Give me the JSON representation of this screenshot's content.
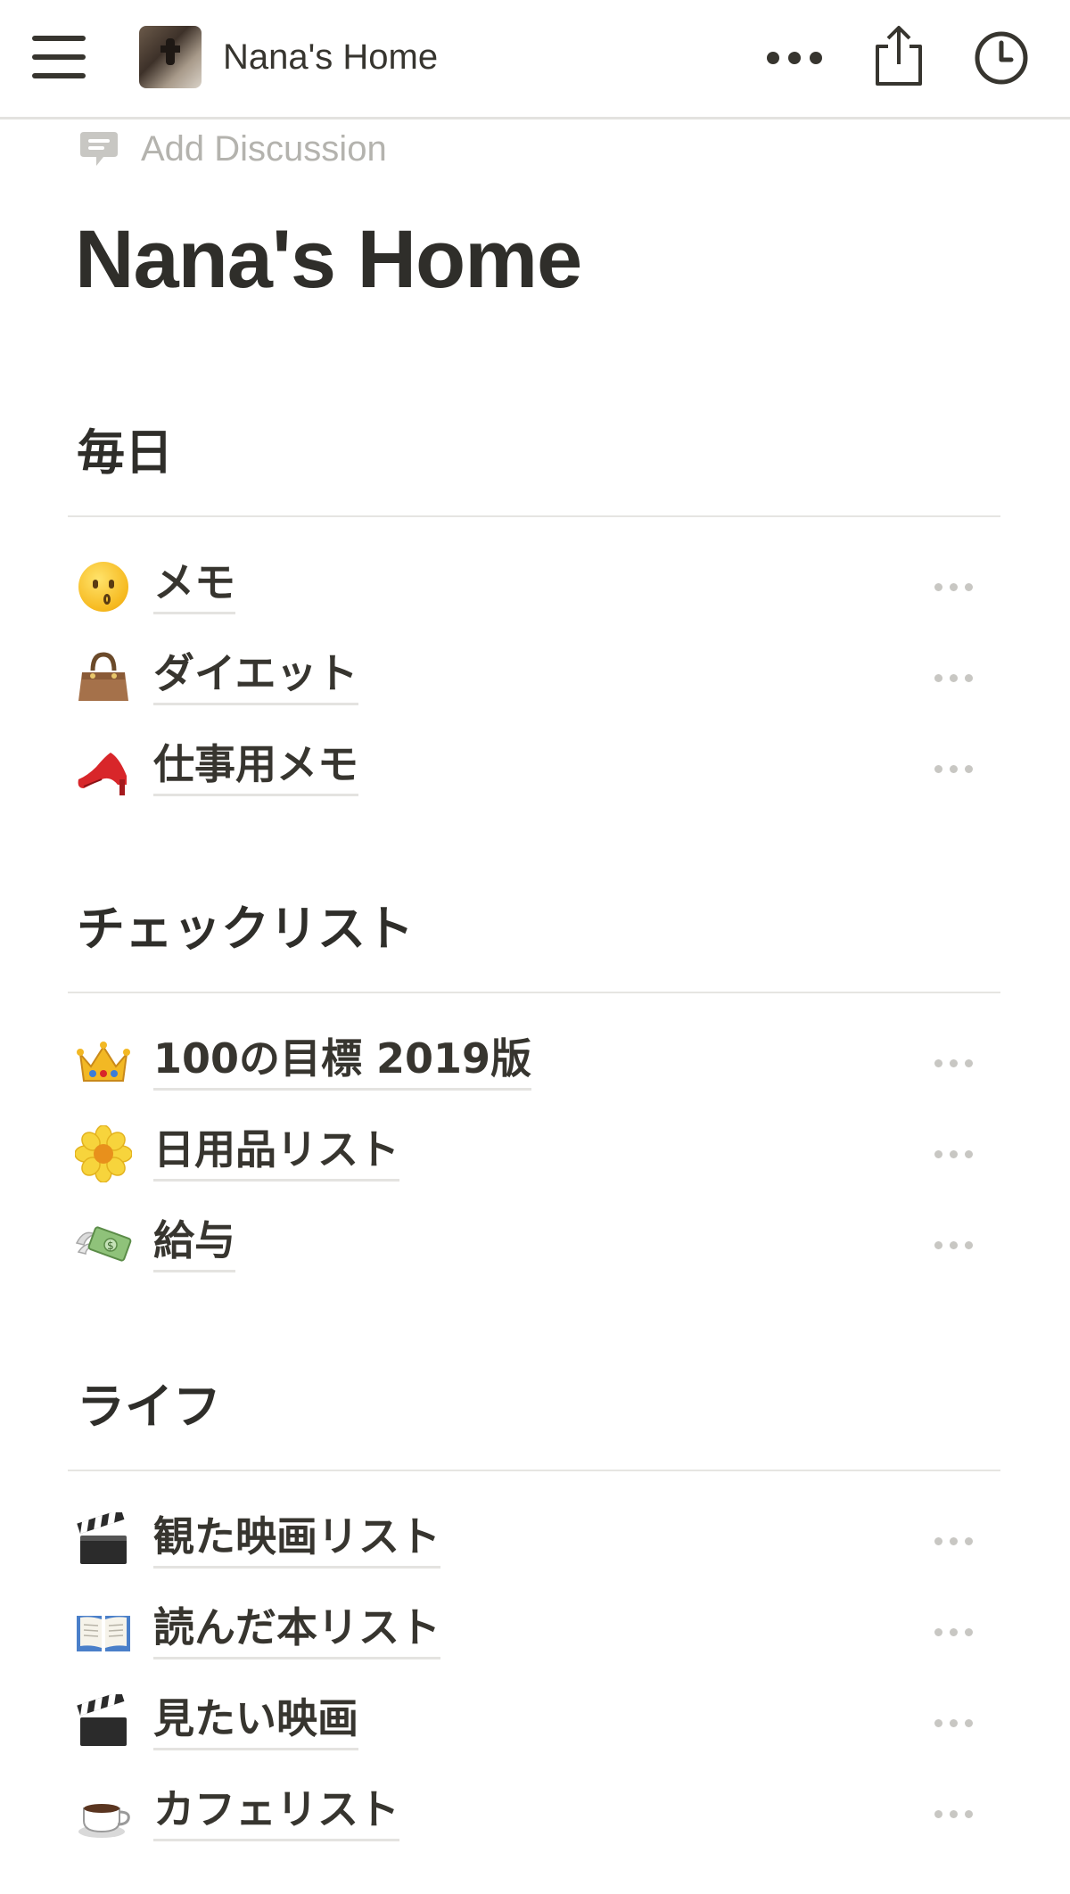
{
  "topbar": {
    "title": "Nana's Home",
    "icons": {
      "menu": "hamburger-menu-icon",
      "more": "more-horizontal-icon",
      "share": "share-icon",
      "history": "clock-icon"
    }
  },
  "discussion": {
    "label": "Add Discussion",
    "icon": "comment-icon"
  },
  "page": {
    "title": "Nana's Home"
  },
  "sections": [
    {
      "heading": "毎日",
      "items": [
        {
          "icon": "kissing-face-emoji",
          "label": "メモ"
        },
        {
          "icon": "handbag-emoji",
          "label": "ダイエット"
        },
        {
          "icon": "high-heel-emoji",
          "label": "仕事用メモ"
        }
      ]
    },
    {
      "heading": "チェックリスト",
      "items": [
        {
          "icon": "crown-emoji",
          "label": "100の目標 2019版"
        },
        {
          "icon": "blossom-emoji",
          "label": "日用品リスト"
        },
        {
          "icon": "money-with-wings-emoji",
          "label": "給与"
        }
      ]
    },
    {
      "heading": "ライフ",
      "items": [
        {
          "icon": "clapper-board-emoji",
          "label": "観た映画リスト"
        },
        {
          "icon": "open-book-emoji",
          "label": "読んだ本リスト"
        },
        {
          "icon": "clapper-board-emoji",
          "label": "見たい映画"
        },
        {
          "icon": "hot-beverage-emoji",
          "label": "カフェリスト"
        }
      ]
    }
  ],
  "colors": {
    "text": "#37352f",
    "muted": "#b4b3ae",
    "divider": "#e6e5e2",
    "dots": "#c8c7c3"
  }
}
